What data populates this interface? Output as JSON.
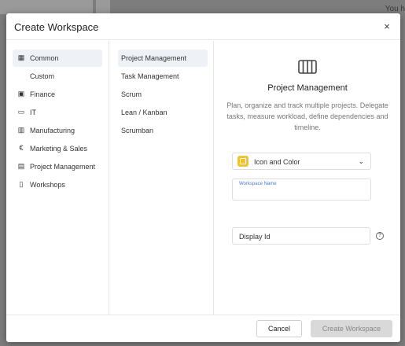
{
  "background": {
    "user_text": "You h"
  },
  "modal": {
    "title": "Create Workspace",
    "close_icon": "×"
  },
  "categories": [
    {
      "label": "Common",
      "icon": "table-icon",
      "glyph": "▦",
      "active": true
    },
    {
      "label": "Custom",
      "icon": "",
      "glyph": "",
      "active": false
    },
    {
      "label": "Finance",
      "icon": "wallet-icon",
      "glyph": "▣",
      "active": false
    },
    {
      "label": "IT",
      "icon": "laptop-icon",
      "glyph": "▭",
      "active": false
    },
    {
      "label": "Manufacturing",
      "icon": "factory-icon",
      "glyph": "▥",
      "active": false
    },
    {
      "label": "Marketing & Sales",
      "icon": "euro-icon",
      "glyph": "€",
      "active": false
    },
    {
      "label": "Project Management",
      "icon": "briefcase-icon",
      "glyph": "▤",
      "active": false
    },
    {
      "label": "Workshops",
      "icon": "clipboard-icon",
      "glyph": "▯",
      "active": false
    }
  ],
  "templates": [
    {
      "label": "Project Management",
      "active": true
    },
    {
      "label": "Task Management",
      "active": false
    },
    {
      "label": "Scrum",
      "active": false
    },
    {
      "label": "Lean / Kanban",
      "active": false
    },
    {
      "label": "Scrumban",
      "active": false
    }
  ],
  "detail": {
    "icon": "columns-icon",
    "title": "Project Management",
    "description": "Plan, organize and track multiple projects. Delegate tasks, measure workload, define dependencies and timeline."
  },
  "form": {
    "icon_color_label": "Icon and Color",
    "icon_color_chevron": "⌄",
    "swatch_color": "#f2c230",
    "workspace_name_label": "Workspace Name",
    "workspace_name_value": "",
    "display_id_placeholder": "Display Id",
    "help_glyph": "?"
  },
  "footer": {
    "cancel_label": "Cancel",
    "create_label": "Create Workspace"
  }
}
